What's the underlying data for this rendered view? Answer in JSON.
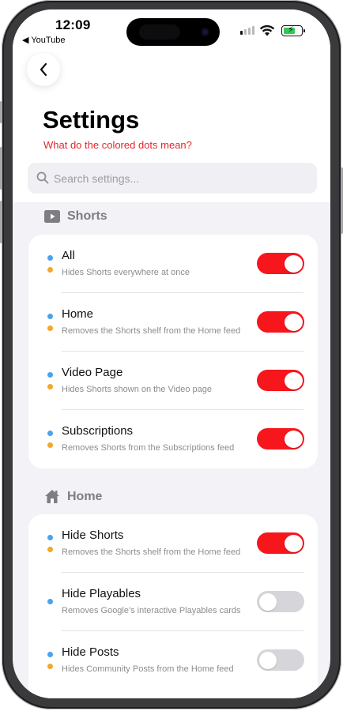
{
  "status_bar": {
    "time": "12:09",
    "back_app": "◀ YouTube"
  },
  "header": {
    "back_icon": "chevron-left-icon",
    "title": "Settings",
    "dots_link": "What do the colored dots mean?",
    "search_placeholder": "Search settings..."
  },
  "colors": {
    "accent": "#e5262b",
    "toggle_on": "#f7161c",
    "dot_blue": "#4aa3ec",
    "dot_orange": "#f3a72b"
  },
  "sections": [
    {
      "title": "Shorts",
      "icon": "play-square-icon",
      "items": [
        {
          "name": "All",
          "desc": "Hides Shorts everywhere at once",
          "on": true
        },
        {
          "name": "Home",
          "desc": "Removes the Shorts shelf from the Home feed",
          "on": true
        },
        {
          "name": "Video Page",
          "desc": "Hides Shorts shown on the Video page",
          "on": true
        },
        {
          "name": "Subscriptions",
          "desc": "Removes Shorts from the Subscriptions feed",
          "on": true
        }
      ]
    },
    {
      "title": "Home",
      "icon": "house-icon",
      "items": [
        {
          "name": "Hide Shorts",
          "desc": "Removes the Shorts shelf from the Home feed",
          "on": true
        },
        {
          "name": "Hide Playables",
          "desc": "Removes Google's interactive Playables cards",
          "on": false
        },
        {
          "name": "Hide Posts",
          "desc": "Hides Community Posts from the Home feed",
          "on": false
        }
      ]
    }
  ]
}
